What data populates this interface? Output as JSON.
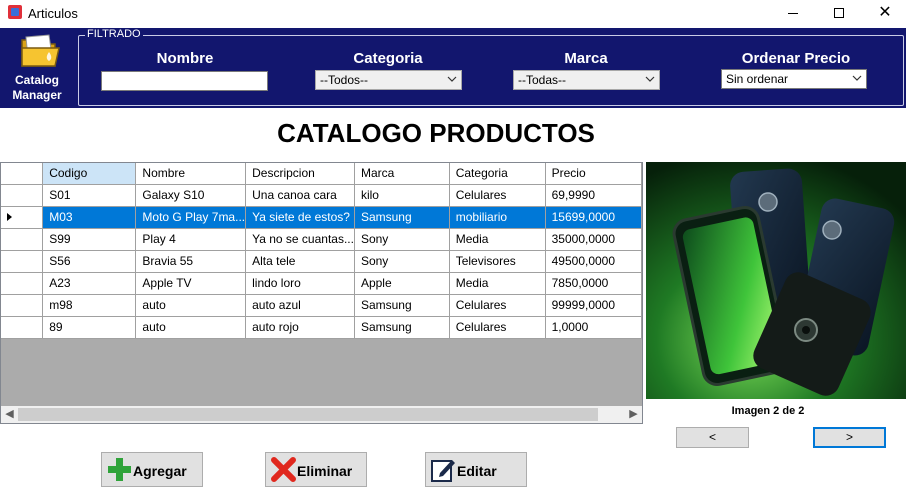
{
  "window": {
    "title": "Articulos"
  },
  "logo": {
    "line1": "Catalog",
    "line2": "Manager"
  },
  "filter": {
    "legend": "FILTRADO",
    "nombre_label": "Nombre",
    "nombre_value": "",
    "categoria_label": "Categoria",
    "categoria_value": "--Todos--",
    "marca_label": "Marca",
    "marca_value": "--Todas--",
    "orden_label": "Ordenar Precio",
    "orden_value": "Sin ordenar"
  },
  "heading": "CATALOGO PRODUCTOS",
  "grid": {
    "columns": [
      "Codigo",
      "Nombre",
      "Descripcion",
      "Marca",
      "Categoria",
      "Precio"
    ],
    "selected_row": 1,
    "rows": [
      [
        "S01",
        "Galaxy S10",
        "Una canoa cara",
        "kilo",
        "Celulares",
        "69,9990"
      ],
      [
        "M03",
        "Moto G Play 7ma...",
        "Ya siete de estos?",
        "Samsung",
        "mobiliario",
        "15699,0000"
      ],
      [
        "S99",
        "Play 4",
        "Ya no se cuantas...",
        "Sony",
        "Media",
        "35000,0000"
      ],
      [
        "S56",
        "Bravia 55",
        "Alta tele",
        "Sony",
        "Televisores",
        "49500,0000"
      ],
      [
        "A23",
        "Apple TV",
        "lindo loro",
        "Apple",
        "Media",
        "7850,0000"
      ],
      [
        "m98",
        "auto",
        "auto azul",
        "Samsung",
        "Celulares",
        "99999,0000"
      ],
      [
        "89",
        "auto",
        "auto rojo",
        "Samsung",
        "Celulares",
        "1,0000"
      ]
    ]
  },
  "image": {
    "caption": "Imagen 2 de 2",
    "prev_label": "<",
    "next_label": ">"
  },
  "actions": {
    "agregar": "Agregar",
    "eliminar": "Eliminar",
    "editar": "Editar"
  },
  "colors": {
    "header_bg": "#12166e",
    "selection": "#0078d7",
    "grid_empty": "#ababab"
  }
}
